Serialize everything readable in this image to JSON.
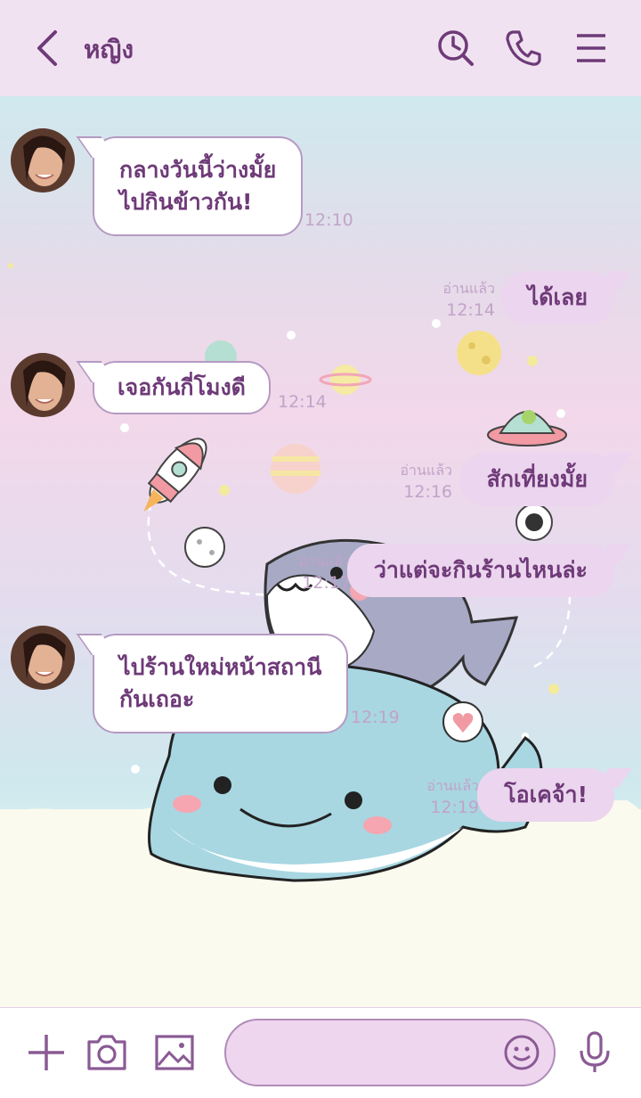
{
  "header": {
    "title": "หญิง",
    "icons": [
      "back-icon",
      "history-icon",
      "phone-icon",
      "menu-icon"
    ]
  },
  "messages": [
    {
      "direction": "in",
      "lines": [
        "กลางวันนี้ว่างมั้ย",
        "ไปกินข้าวกัน!"
      ],
      "time": "12:10"
    },
    {
      "direction": "out",
      "text": "ได้เลย",
      "read": "อ่านแล้ว",
      "time": "12:14"
    },
    {
      "direction": "in",
      "lines": [
        "เจอกันกี่โมงดี"
      ],
      "time": "12:14"
    },
    {
      "direction": "out",
      "text": "สักเที่ยงมั้ย",
      "read": "อ่านแล้ว",
      "time": "12:16"
    },
    {
      "direction": "out",
      "text": "ว่าแต่จะกินร้านไหนล่ะ",
      "read": "อ่านแล้ว",
      "time": "12:17"
    },
    {
      "direction": "in",
      "lines": [
        "ไปร้านใหม่หน้าสถานี",
        "กันเถอะ"
      ],
      "time": "12:19"
    },
    {
      "direction": "out",
      "text": "โอเคจ้า!",
      "read": "อ่านแล้ว",
      "time": "12:19"
    }
  ],
  "input_bar": {
    "icons": [
      "plus-icon",
      "camera-icon",
      "image-icon",
      "emoji-icon",
      "microphone-icon"
    ],
    "placeholder": ""
  },
  "colors": {
    "accent": "#6e3a78",
    "header_bg": "#f1e2f1",
    "bubble_out": "#ecd5ee",
    "timestamp": "#c2a3c9"
  }
}
